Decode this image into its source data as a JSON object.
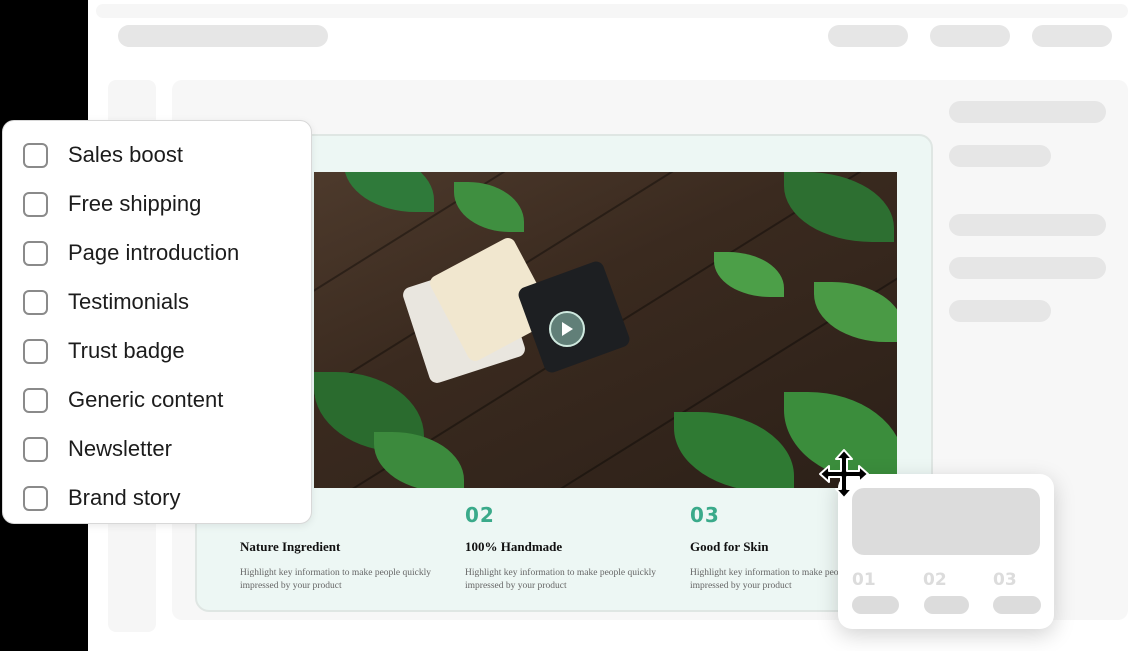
{
  "checklist": {
    "items": [
      {
        "label": "Sales boost"
      },
      {
        "label": "Free shipping"
      },
      {
        "label": "Page introduction"
      },
      {
        "label": "Testimonials"
      },
      {
        "label": "Trust badge"
      },
      {
        "label": "Generic content"
      },
      {
        "label": "Newsletter"
      },
      {
        "label": "Brand story"
      }
    ]
  },
  "section": {
    "hero_icon": "play-icon",
    "features": [
      {
        "number": "",
        "title": "Nature Ingredient",
        "desc": "Highlight key information to make people quickly impressed by your product"
      },
      {
        "number": "02",
        "title": "100% Handmade",
        "desc": "Highlight key information to make people quickly impressed by your product"
      },
      {
        "number": "03",
        "title": "Good for Skin",
        "desc": "Highlight key information to make people quickly impressed by your product"
      }
    ],
    "accent_color": "#3aaa8a"
  },
  "mini_card": {
    "numbers": [
      "01",
      "02",
      "03"
    ]
  },
  "cursor": {
    "icon": "move-cursor-icon"
  }
}
